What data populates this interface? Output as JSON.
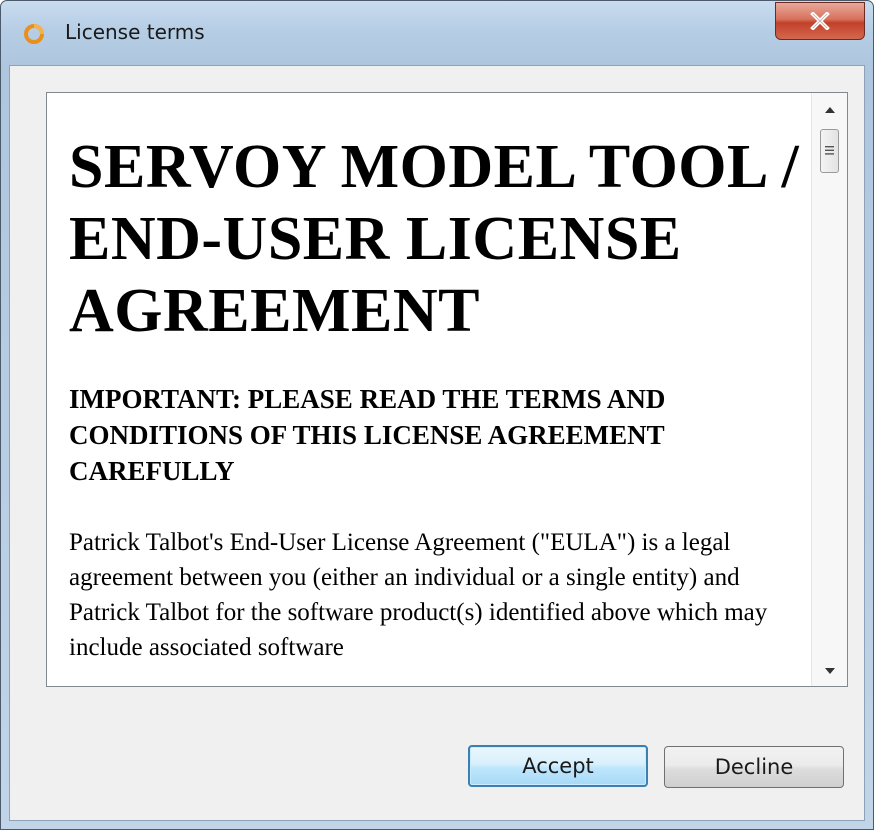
{
  "window": {
    "title": "License terms",
    "icon": "servoy-logo-icon",
    "close_icon": "close-icon"
  },
  "license": {
    "heading": "SERVOY MODEL TOOL / END-USER LICENSE AGREEMENT",
    "subheading": "IMPORTANT: PLEASE READ THE TERMS AND CONDITIONS OF THIS LICENSE AGREEMENT CAREFULLY",
    "paragraph": "Patrick Talbot's End-User License Agreement (\"EULA\") is a legal agreement between you (either an individual or a single entity) and Patrick Talbot for the software product(s) identified above which may include associated software"
  },
  "scrollbar": {
    "up_icon": "scroll-up-arrow-icon",
    "down_icon": "scroll-down-arrow-icon",
    "thumb_icon": "scroll-thumb-grip-icon"
  },
  "buttons": {
    "accept_label": "Accept",
    "decline_label": "Decline"
  },
  "colors": {
    "close_button": "#c2412a",
    "accept_border": "#3c7fb1"
  }
}
